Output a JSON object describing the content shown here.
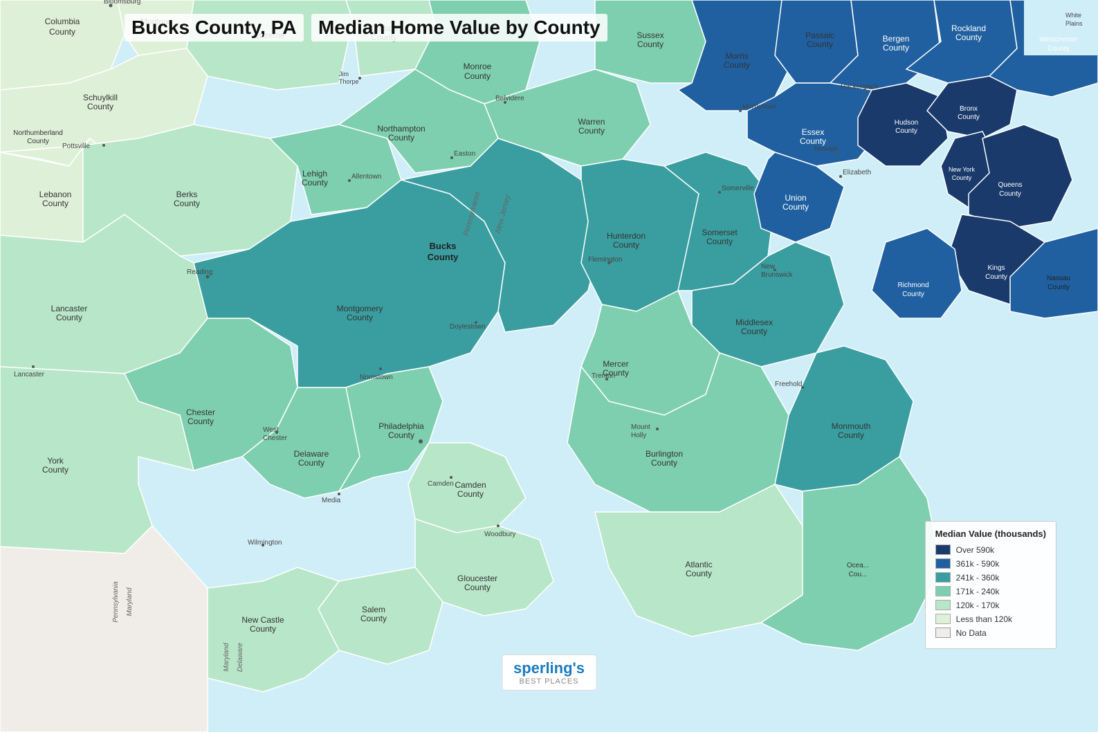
{
  "title": {
    "county_title": "Bucks County, PA",
    "main_title": "Median Home Value by County"
  },
  "legend": {
    "title": "Median Value (thousands)",
    "items": [
      {
        "label": "Over 590k",
        "color": "#1a3a6b"
      },
      {
        "label": "361k - 590k",
        "color": "#2060a0"
      },
      {
        "label": "241k - 360k",
        "color": "#3a9ea0"
      },
      {
        "label": "171k - 240k",
        "color": "#7ecfb0"
      },
      {
        "label": "120k - 170k",
        "color": "#b8e6c8"
      },
      {
        "label": "Less than 120k",
        "color": "#dff0d8"
      },
      {
        "label": "No Data",
        "color": "#f0ede8"
      }
    ]
  },
  "counties": [
    {
      "name": "Columbia County",
      "color": "#dff0d8"
    },
    {
      "name": "Montour County",
      "color": "#dff0d8"
    },
    {
      "name": "Northumberland County",
      "color": "#dff0d8"
    },
    {
      "name": "Schuylkill County",
      "color": "#dff0d8"
    },
    {
      "name": "Lebanon County",
      "color": "#dff0d8"
    },
    {
      "name": "Berks County",
      "color": "#b8e6c8"
    },
    {
      "name": "Lancaster County",
      "color": "#b8e6c8"
    },
    {
      "name": "Chester County",
      "color": "#7ecfb0"
    },
    {
      "name": "York County",
      "color": "#b8e6c8"
    },
    {
      "name": "Delaware County",
      "color": "#7ecfb0"
    },
    {
      "name": "Philadelphia County",
      "color": "#7ecfb0"
    },
    {
      "name": "Montgomery County",
      "color": "#7ecfb0"
    },
    {
      "name": "Bucks County",
      "color": "#3a9ea0"
    },
    {
      "name": "Lehigh County",
      "color": "#7ecfb0"
    },
    {
      "name": "Northampton County",
      "color": "#7ecfb0"
    },
    {
      "name": "New Castle County",
      "color": "#b8e6c8"
    },
    {
      "name": "Salem County",
      "color": "#b8e6c8"
    },
    {
      "name": "Gloucester County",
      "color": "#b8e6c8"
    },
    {
      "name": "Camden County",
      "color": "#b8e6c8"
    },
    {
      "name": "Burlington County",
      "color": "#7ecfb0"
    },
    {
      "name": "Atlantic County",
      "color": "#b8e6c8"
    },
    {
      "name": "Mercer County",
      "color": "#7ecfb0"
    },
    {
      "name": "Hunterdon County",
      "color": "#3a9ea0"
    },
    {
      "name": "Somerset County",
      "color": "#3a9ea0"
    },
    {
      "name": "Middlesex County",
      "color": "#3a9ea0"
    },
    {
      "name": "Monmouth County",
      "color": "#3a9ea0"
    },
    {
      "name": "Union County",
      "color": "#2060a0"
    },
    {
      "name": "Essex County",
      "color": "#2060a0"
    },
    {
      "name": "Morris County",
      "color": "#2060a0"
    },
    {
      "name": "Warren County",
      "color": "#7ecfb0"
    },
    {
      "name": "Sussex County",
      "color": "#7ecfb0"
    },
    {
      "name": "Monroe County",
      "color": "#7ecfb0"
    },
    {
      "name": "Carbon County",
      "color": "#b8e6c8"
    },
    {
      "name": "Luzerne County",
      "color": "#b8e6c8"
    },
    {
      "name": "Hudson County",
      "color": "#1a3a6b"
    },
    {
      "name": "Bergen County",
      "color": "#2060a0"
    },
    {
      "name": "Passaic County",
      "color": "#2060a0"
    },
    {
      "name": "Rockland County",
      "color": "#2060a0"
    },
    {
      "name": "Westchester County",
      "color": "#2060a0"
    },
    {
      "name": "Bronx County",
      "color": "#1a3a6b"
    },
    {
      "name": "New York County",
      "color": "#1a3a6b"
    },
    {
      "name": "Queens County",
      "color": "#1a3a6b"
    },
    {
      "name": "Kings County",
      "color": "#1a3a6b"
    },
    {
      "name": "Richmond County",
      "color": "#2060a0"
    },
    {
      "name": "Nassau County",
      "color": "#2060a0"
    },
    {
      "name": "Ocean County",
      "color": "#7ecfb0"
    }
  ],
  "sperlings": {
    "name": "sperling's",
    "sub": "BEST PLACES"
  }
}
